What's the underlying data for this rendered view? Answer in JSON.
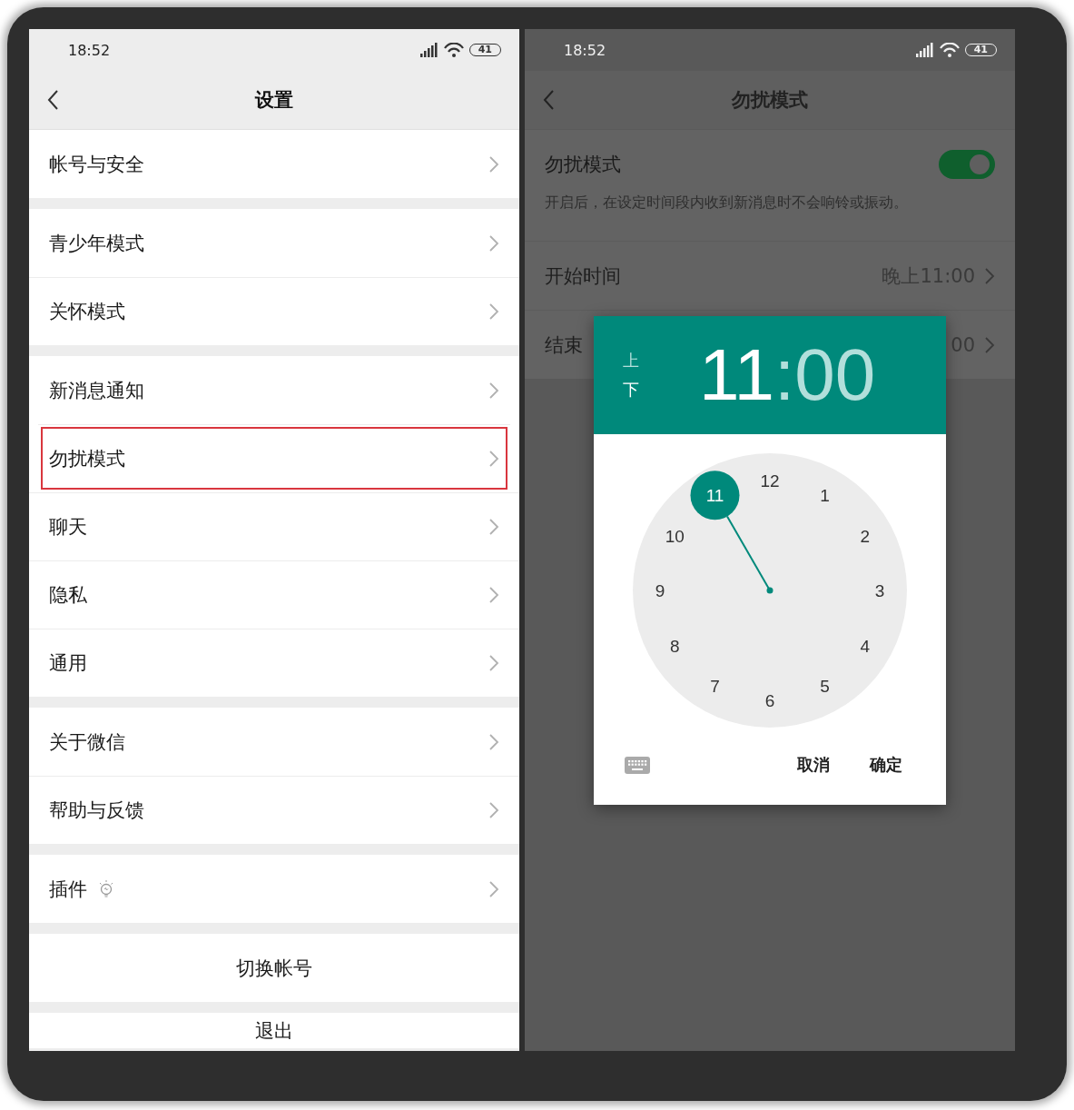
{
  "left": {
    "status_bar": {
      "time": "18:52",
      "battery": "41"
    },
    "title": "设置",
    "groups": [
      [
        {
          "label": "帐号与安全",
          "kind": "plain",
          "highlighted": false
        }
      ],
      [
        {
          "label": "青少年模式",
          "kind": "plain",
          "highlighted": false
        },
        {
          "label": "关怀模式",
          "kind": "plain",
          "highlighted": false
        }
      ],
      [
        {
          "label": "新消息通知",
          "kind": "plain",
          "highlighted": false
        },
        {
          "label": "勿扰模式",
          "kind": "plain",
          "highlighted": true
        },
        {
          "label": "聊天",
          "kind": "plain",
          "highlighted": false
        },
        {
          "label": "隐私",
          "kind": "plain",
          "highlighted": false
        },
        {
          "label": "通用",
          "kind": "plain",
          "highlighted": false
        }
      ],
      [
        {
          "label": "关于微信",
          "kind": "plain",
          "highlighted": false
        },
        {
          "label": "帮助与反馈",
          "kind": "plain",
          "highlighted": false
        }
      ],
      [
        {
          "label": "插件",
          "kind": "with-icon",
          "highlighted": false
        }
      ]
    ],
    "actions": [
      "切换帐号",
      "退出"
    ]
  },
  "right": {
    "status_bar": {
      "time": "18:52",
      "battery": "41"
    },
    "title": "勿扰模式",
    "toggle": {
      "label": "勿扰模式",
      "on": true,
      "description": "开启后，在设定时间段内收到新消息时不会响铃或振动。"
    },
    "rows": [
      {
        "label": "开始时间",
        "value": "晚上11:00"
      },
      {
        "label": "结束",
        "value": "00"
      }
    ],
    "dialog": {
      "periods": [
        {
          "label": "上",
          "selected": false
        },
        {
          "label": "下",
          "selected": true
        }
      ],
      "hour": {
        "text": "11",
        "selected": true
      },
      "separator": ":",
      "minute": {
        "text": "00",
        "selected": false
      },
      "dial": [
        {
          "label": "12",
          "selected": false
        },
        {
          "label": "1",
          "selected": false
        },
        {
          "label": "2",
          "selected": false
        },
        {
          "label": "3",
          "selected": false
        },
        {
          "label": "4",
          "selected": false
        },
        {
          "label": "5",
          "selected": false
        },
        {
          "label": "6",
          "selected": false
        },
        {
          "label": "7",
          "selected": false
        },
        {
          "label": "8",
          "selected": false
        },
        {
          "label": "9",
          "selected": false
        },
        {
          "label": "10",
          "selected": false
        },
        {
          "label": "11",
          "selected": true
        }
      ],
      "buttons": [
        "取消",
        "确定"
      ]
    }
  }
}
